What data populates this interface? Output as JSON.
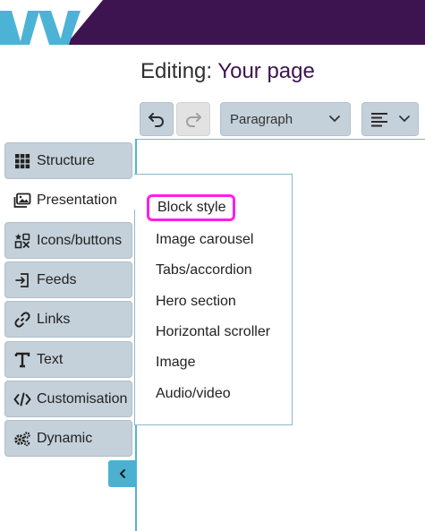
{
  "header": {
    "brand_color": "#3d1450",
    "logo_icon": "w-logo-icon"
  },
  "title": {
    "prefix": "Editing:",
    "page_name": "Your page"
  },
  "toolbar": {
    "undo_icon": "undo-icon",
    "redo_icon": "redo-icon",
    "block_format": "Paragraph",
    "align_icon": "align-left-icon"
  },
  "sidebar": {
    "items": [
      {
        "label": "Structure",
        "icon": "grid-icon"
      },
      {
        "label": "Presentation",
        "icon": "images-icon",
        "active": true
      },
      {
        "label": "Icons/buttons",
        "icon": "icons-icon"
      },
      {
        "label": "Feeds",
        "icon": "feed-import-icon"
      },
      {
        "label": "Links",
        "icon": "link-icon"
      },
      {
        "label": "Text",
        "icon": "text-t-icon"
      },
      {
        "label": "Customisation",
        "icon": "code-icon"
      },
      {
        "label": "Dynamic",
        "icon": "gears-icon"
      }
    ],
    "collapse_icon": "chevron-left-icon"
  },
  "presentation_menu": {
    "items": [
      "Block style",
      "Image carousel",
      "Tabs/accordion",
      "Hero section",
      "Horizontal scroller",
      "Image",
      "Audio/video"
    ],
    "focused_index": 0,
    "focus_color": "#ff1ee8"
  }
}
